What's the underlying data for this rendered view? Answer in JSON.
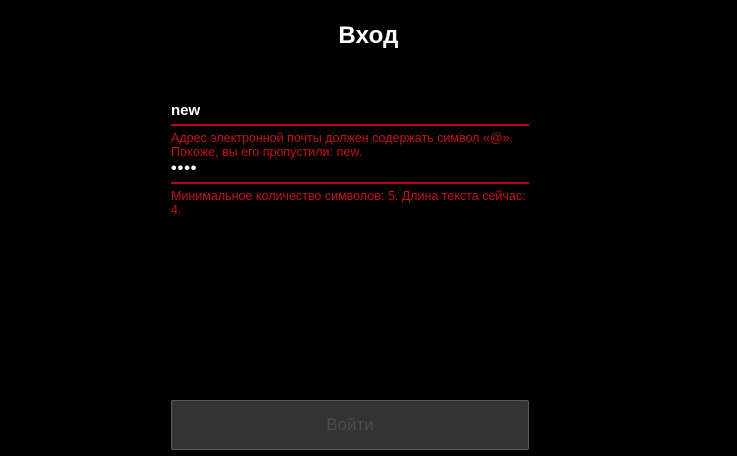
{
  "login": {
    "title": "Вход",
    "email": {
      "value": "new",
      "error": "Адрес электронной почты должен содержать символ «@». Похоже, вы его пропустили: new."
    },
    "password": {
      "value": "••••",
      "error": "Минимальное количество символов: 5. Длина текста сейчас: 4."
    },
    "submit_label": "Войти"
  },
  "colors": {
    "background": "#000000",
    "error": "#c2141b",
    "underline": "#b3090f",
    "button_bg": "#333333"
  }
}
